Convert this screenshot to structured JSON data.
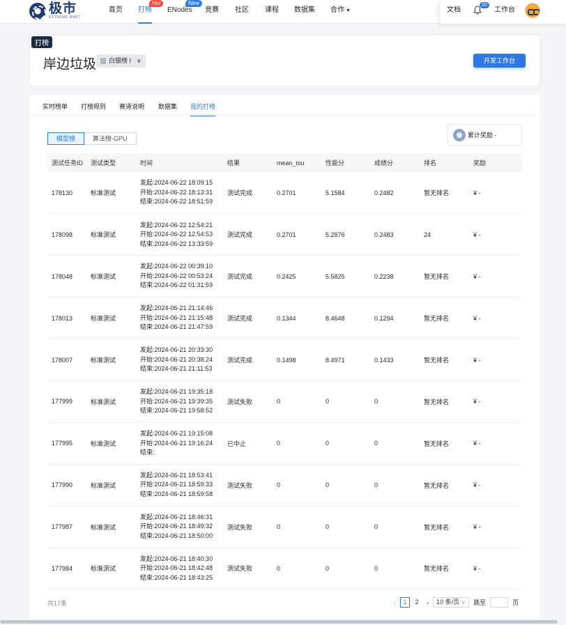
{
  "nav": {
    "logo_cn": "极市",
    "logo_en": "EXTREME MART",
    "items": [
      {
        "label": "首页"
      },
      {
        "label": "打榜",
        "badge": "Hot"
      },
      {
        "label": "ENodes",
        "badge": "New"
      },
      {
        "label": "竞赛"
      },
      {
        "label": "社区"
      },
      {
        "label": "课程"
      },
      {
        "label": "数据集"
      },
      {
        "label": "合作"
      }
    ],
    "docs": "文档",
    "notif_count": "20",
    "workspace": "工作台"
  },
  "header": {
    "tag": "打榜",
    "title": "岸边垃圾",
    "board": "白银榜 I",
    "dev_button": "开发工作台"
  },
  "tabs": [
    "实时榜单",
    "打榜规则",
    "赛道说明",
    "数据集",
    "我的打榜"
  ],
  "segments": [
    "模型榜",
    "算法榜-GPU"
  ],
  "reward": "累计奖励 -",
  "columns": [
    "测试任务ID",
    "测试类型",
    "时间",
    "结果",
    "mean_iou",
    "性能分",
    "成绩分",
    "排名",
    "奖励"
  ],
  "rows": [
    {
      "id": "178130",
      "type": "标准测试",
      "start": "发起:2024-06-22 18:09:15",
      "begin": "开始:2024-06-22 18:13:31",
      "end": "结束:2024-06-22 18:51:59",
      "result": "测试完成",
      "miou": "0.2701",
      "perf": "5.1584",
      "score": "0.2482",
      "rank": "暂无排名",
      "reward": "¥ -"
    },
    {
      "id": "178098",
      "type": "标准测试",
      "start": "发起:2024-06-22 12:54:21",
      "begin": "开始:2024-06-22 12:54:53",
      "end": "结束:2024-06-22 13:33:59",
      "result": "测试完成",
      "miou": "0.2701",
      "perf": "5.2876",
      "score": "0.2483",
      "rank": "24",
      "reward": "¥ -"
    },
    {
      "id": "178048",
      "type": "标准测试",
      "start": "发起:2024-06-22 00:39:10",
      "begin": "开始:2024-06-22 00:53:24",
      "end": "结束:2024-06-22 01:31:59",
      "result": "测试完成",
      "miou": "0.2425",
      "perf": "5.5825",
      "score": "0.2238",
      "rank": "暂无排名",
      "reward": "¥ -"
    },
    {
      "id": "178013",
      "type": "标准测试",
      "start": "发起:2024-06-21 21:14:46",
      "begin": "开始:2024-06-21 21:15:48",
      "end": "结束:2024-06-21 21:47:59",
      "result": "测试完成",
      "miou": "0.1344",
      "perf": "8.4648",
      "score": "0.1294",
      "rank": "暂无排名",
      "reward": "¥ -"
    },
    {
      "id": "178007",
      "type": "标准测试",
      "start": "发起:2024-06-21 20:33:30",
      "begin": "开始:2024-06-21 20:38:24",
      "end": "结束:2024-06-21 21:11:53",
      "result": "测试完成",
      "miou": "0.1498",
      "perf": "8.4971",
      "score": "0.1433",
      "rank": "暂无排名",
      "reward": "¥ -"
    },
    {
      "id": "177999",
      "type": "标准测试",
      "start": "发起:2024-06-21 19:35:18",
      "begin": "开始:2024-06-21 19:39:35",
      "end": "结束:2024-06-21 19:58:52",
      "result": "测试失败",
      "miou": "0",
      "perf": "0",
      "score": "0",
      "rank": "暂无排名",
      "reward": "¥ -"
    },
    {
      "id": "177995",
      "type": "标准测试",
      "start": "发起:2024-06-21 19:15:08",
      "begin": "开始:2024-06-21 19:16:24",
      "end": "结束:",
      "result": "已中止",
      "miou": "0",
      "perf": "0",
      "score": "0",
      "rank": "暂无排名",
      "reward": "¥ -"
    },
    {
      "id": "177990",
      "type": "标准测试",
      "start": "发起:2024-06-21 18:53:41",
      "begin": "开始:2024-06-21 18:59:33",
      "end": "结束:2024-06-21 18:59:58",
      "result": "测试失败",
      "miou": "0",
      "perf": "0",
      "score": "0",
      "rank": "暂无排名",
      "reward": "¥ -"
    },
    {
      "id": "177987",
      "type": "标准测试",
      "start": "发起:2024-06-21 18:46:31",
      "begin": "开始:2024-06-21 18:49:32",
      "end": "结束:2024-06-21 18:50:00",
      "result": "测试失败",
      "miou": "0",
      "perf": "0",
      "score": "0",
      "rank": "暂无排名",
      "reward": "¥ -"
    },
    {
      "id": "177984",
      "type": "标准测试",
      "start": "发起:2024-06-21 18:40:30",
      "begin": "开始:2024-06-21 18:42:48",
      "end": "结束:2024-06-21 18:43:25",
      "result": "测试失败",
      "miou": "0",
      "perf": "0",
      "score": "0",
      "rank": "暂无排名",
      "reward": "¥ -"
    }
  ],
  "footer": {
    "total": "共17条",
    "pages": [
      "1",
      "2"
    ],
    "page_size": "10 条/页",
    "jump_label": "跳至",
    "page_unit": "页"
  },
  "colors": {
    "accent": "#2c7be5",
    "hot": "#f5483b",
    "tag_bg": "#1e2b45"
  }
}
